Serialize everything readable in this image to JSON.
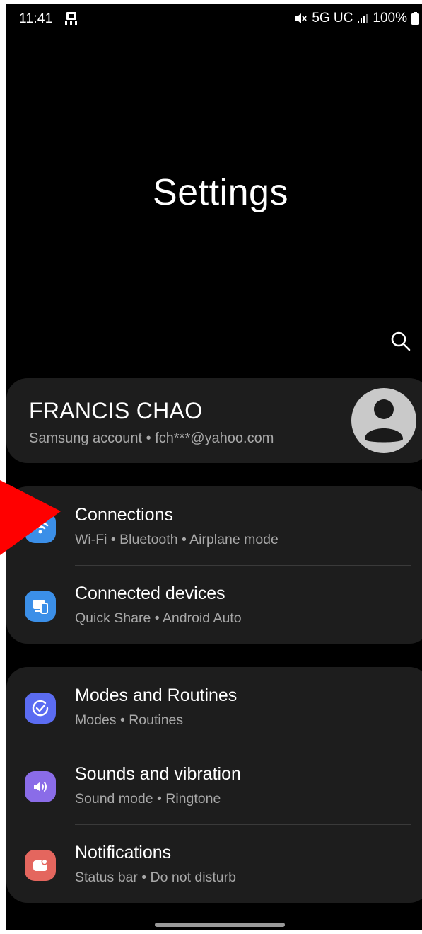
{
  "status_bar": {
    "time": "11:41",
    "network": "5G UC",
    "battery": "100%",
    "icons": [
      "notification-icon",
      "mute-icon",
      "signal-icon",
      "battery-icon"
    ]
  },
  "page": {
    "title": "Settings",
    "search_icon": "search-icon"
  },
  "account": {
    "name": "FRANCIS CHAO",
    "subtitle": "Samsung account  •  fch***@yahoo.com",
    "avatar_icon": "person-icon"
  },
  "group1": [
    {
      "title": "Connections",
      "subtitle": "Wi-Fi  •  Bluetooth  •  Airplane mode",
      "icon": "wifi-icon",
      "color": "#3b8fe8"
    },
    {
      "title": "Connected devices",
      "subtitle": "Quick Share  •  Android Auto",
      "icon": "devices-icon",
      "color": "#3b8fe8"
    }
  ],
  "group2": [
    {
      "title": "Modes and Routines",
      "subtitle": "Modes  •  Routines",
      "icon": "routines-icon",
      "color": "#5b6cf2"
    },
    {
      "title": "Sounds and vibration",
      "subtitle": "Sound mode  •  Ringtone",
      "icon": "volume-icon",
      "color": "#8a6ce8"
    },
    {
      "title": "Notifications",
      "subtitle": "Status bar  •  Do not disturb",
      "icon": "notifications-icon",
      "color": "#e4665e"
    }
  ],
  "colors": {
    "background": "#000000",
    "card": "#1d1d1d",
    "text_primary": "#ffffff",
    "text_secondary": "#a8a8a8",
    "annotation_arrow": "#ff0000"
  }
}
